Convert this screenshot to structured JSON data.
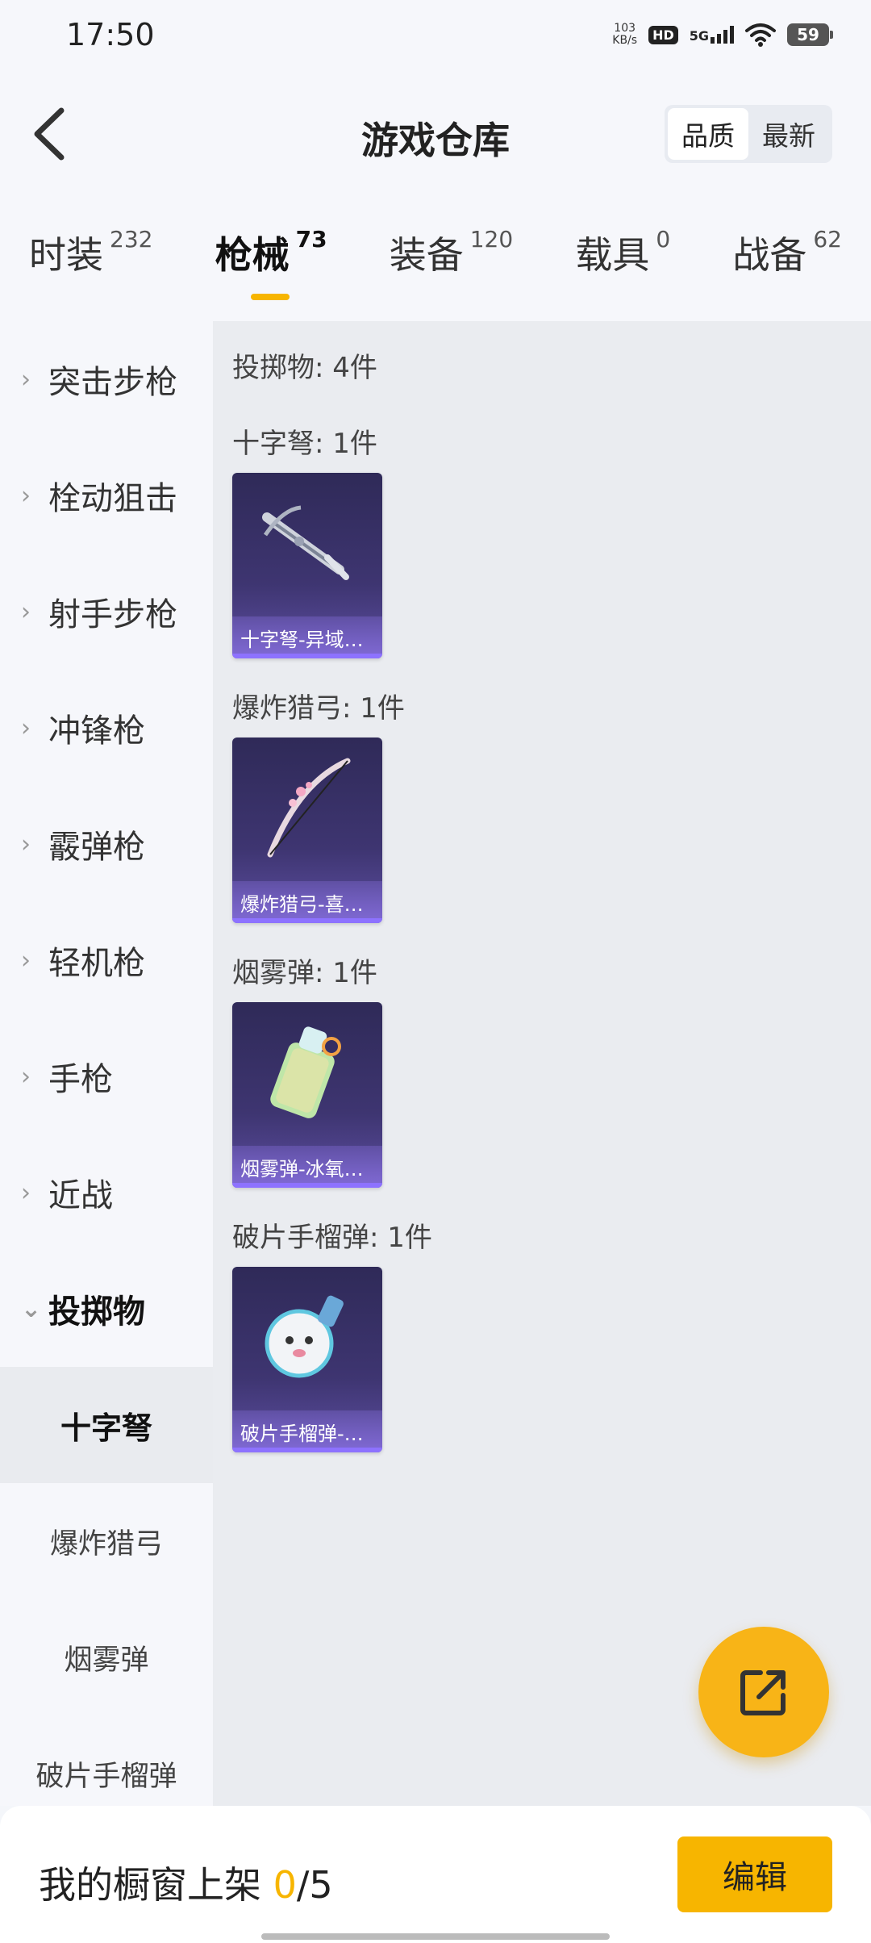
{
  "status_bar": {
    "time": "17:50",
    "net_speed_value": "103",
    "net_speed_unit": "KB/s",
    "hd_badge": "HD",
    "network": "5G",
    "battery": "59"
  },
  "header": {
    "title": "游戏仓库",
    "sort_options": [
      "品质",
      "最新"
    ],
    "active_sort": "品质"
  },
  "tabs": [
    {
      "label": "时装",
      "count": "232"
    },
    {
      "label": "枪械",
      "count": "73",
      "active": true
    },
    {
      "label": "装备",
      "count": "120"
    },
    {
      "label": "载具",
      "count": "0"
    },
    {
      "label": "战备",
      "count": "62"
    }
  ],
  "sidebar": {
    "categories": [
      "突击步枪",
      "栓动狙击",
      "射手步枪",
      "冲锋枪",
      "霰弹枪",
      "轻机枪",
      "手枪",
      "近战",
      "投掷物"
    ],
    "open_category": "投掷物",
    "subcategories": [
      "十字弩",
      "爆炸猎弓",
      "烟雾弹",
      "破片手榴弹"
    ],
    "active_subcategory": "十字弩"
  },
  "content": {
    "total_label": "投掷物: 4件",
    "groups": [
      {
        "label": "十字弩: 1件",
        "item_name": "十字弩-异域…"
      },
      {
        "label": "爆炸猎弓: 1件",
        "item_name": "爆炸猎弓-喜…"
      },
      {
        "label": "烟雾弹: 1件",
        "item_name": "烟雾弹-冰氧…"
      },
      {
        "label": "破片手榴弹: 1件",
        "item_name": "破片手榴弹-…"
      }
    ]
  },
  "bottom_bar": {
    "showcase_label": "我的橱窗上架 ",
    "showcase_current": "0",
    "showcase_total": "/5",
    "edit_button": "编辑"
  },
  "colors": {
    "accent": "#f7b500",
    "card_bg": "#3e3571"
  },
  "icons": [
    "back-arrow-icon",
    "chevron-right-icon",
    "chevron-down-icon",
    "share-export-icon",
    "wifi-icon",
    "signal-icon",
    "battery-icon"
  ]
}
